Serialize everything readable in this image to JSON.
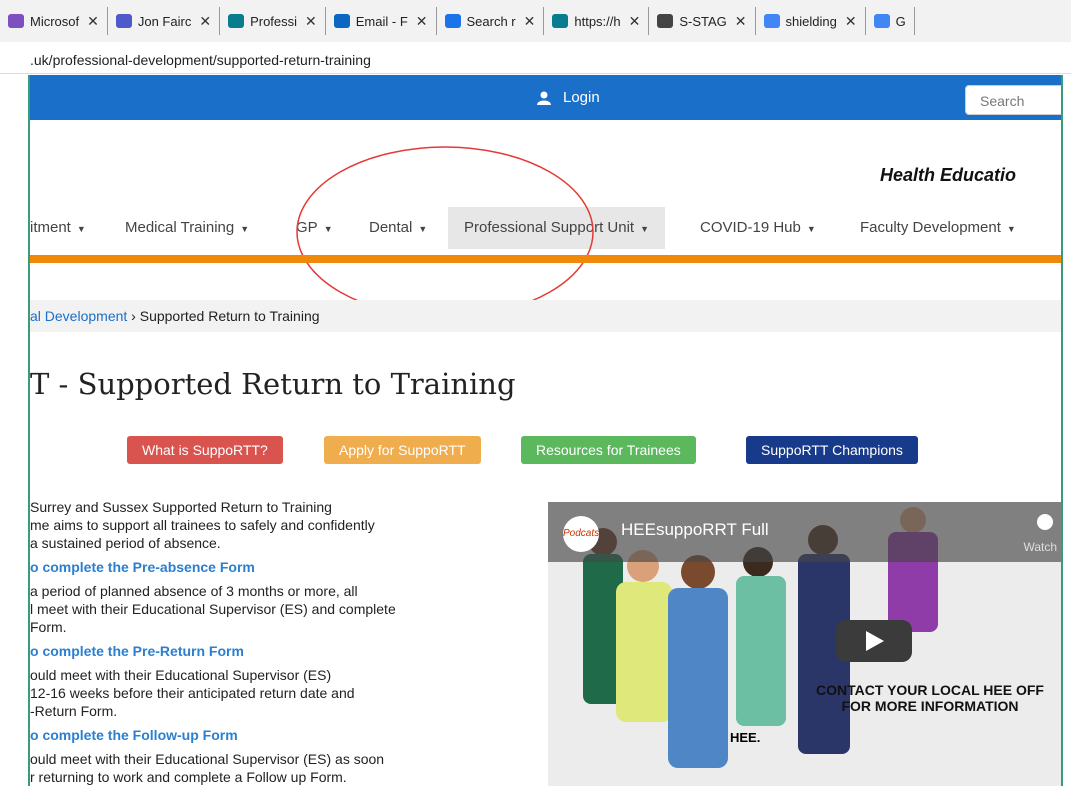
{
  "browser": {
    "tabs": [
      {
        "label": "Microsof",
        "icon": "microsoft-icon",
        "color": "#7d4fbf"
      },
      {
        "label": "Jon Fairc",
        "icon": "teams-icon",
        "color": "#5059c9"
      },
      {
        "label": "Professi",
        "icon": "sharepoint-icon",
        "color": "#0a7c8f"
      },
      {
        "label": "Email - F",
        "icon": "outlook-icon",
        "color": "#0b67c2"
      },
      {
        "label": "Search r",
        "icon": "onedrive-icon",
        "color": "#1a73e8"
      },
      {
        "label": "https://h",
        "icon": "sharepoint-icon",
        "color": "#0a7c8f"
      },
      {
        "label": "S-STAG",
        "icon": "chrome-icon",
        "color": "#444444"
      },
      {
        "label": "shielding",
        "icon": "google-icon",
        "color": "#4285f4"
      },
      {
        "label": "G",
        "icon": "google-icon",
        "color": "#4285f4"
      }
    ],
    "url": ".uk/professional-development/supported-return-training"
  },
  "site": {
    "login_label": "Login",
    "search_placeholder": "Search",
    "brand": "Health Educatio"
  },
  "nav": {
    "items": [
      {
        "label": "itment"
      },
      {
        "label": "Medical Training"
      },
      {
        "label": "GP"
      },
      {
        "label": "Dental"
      },
      {
        "label": "Professional Support Unit"
      },
      {
        "label": "COVID-19 Hub"
      },
      {
        "label": "Faculty Development"
      }
    ]
  },
  "breadcrumb": {
    "parent": "al Development",
    "sep": "›",
    "current": "Supported Return to Training"
  },
  "page": {
    "title": "T - Supported Return to Training",
    "buttons": [
      {
        "label": "What is SuppoRTT?",
        "color": "#d9534f"
      },
      {
        "label": "Apply for SuppoRTT",
        "color": "#f0ad4e"
      },
      {
        "label": "Resources for Trainees",
        "color": "#5cb85c"
      },
      {
        "label": "SuppoRTT Champions",
        "color": "#173b8a"
      }
    ],
    "intro": [
      "Surrey and Sussex Supported Return to Training",
      "me aims to support all trainees to safely and confidently",
      "a sustained period of absence."
    ],
    "sections": [
      {
        "heading": "o complete the Pre-absence Form",
        "lines": [
          "a period of planned absence of 3 months or more, all",
          "l meet with their Educational Supervisor (ES) and complete",
          "Form."
        ]
      },
      {
        "heading": "o complete the Pre-Return Form",
        "lines": [
          "ould meet with their Educational Supervisor (ES)",
          "12-16 weeks before their anticipated return date and",
          "-Return Form."
        ]
      },
      {
        "heading": "o complete the Follow-up Form",
        "lines": [
          "ould meet with their Educational Supervisor (ES) as soon",
          "r returning to work and complete a Follow up Form."
        ]
      }
    ]
  },
  "video": {
    "logo_text": "Podcats",
    "title": "HEEsuppoRRT Full",
    "watch_label": "Watch",
    "contact_line1": "CONTACT YOUR LOCAL HEE OFF",
    "contact_line2": "FOR MORE INFORMATION",
    "hee_text": "HEE."
  }
}
